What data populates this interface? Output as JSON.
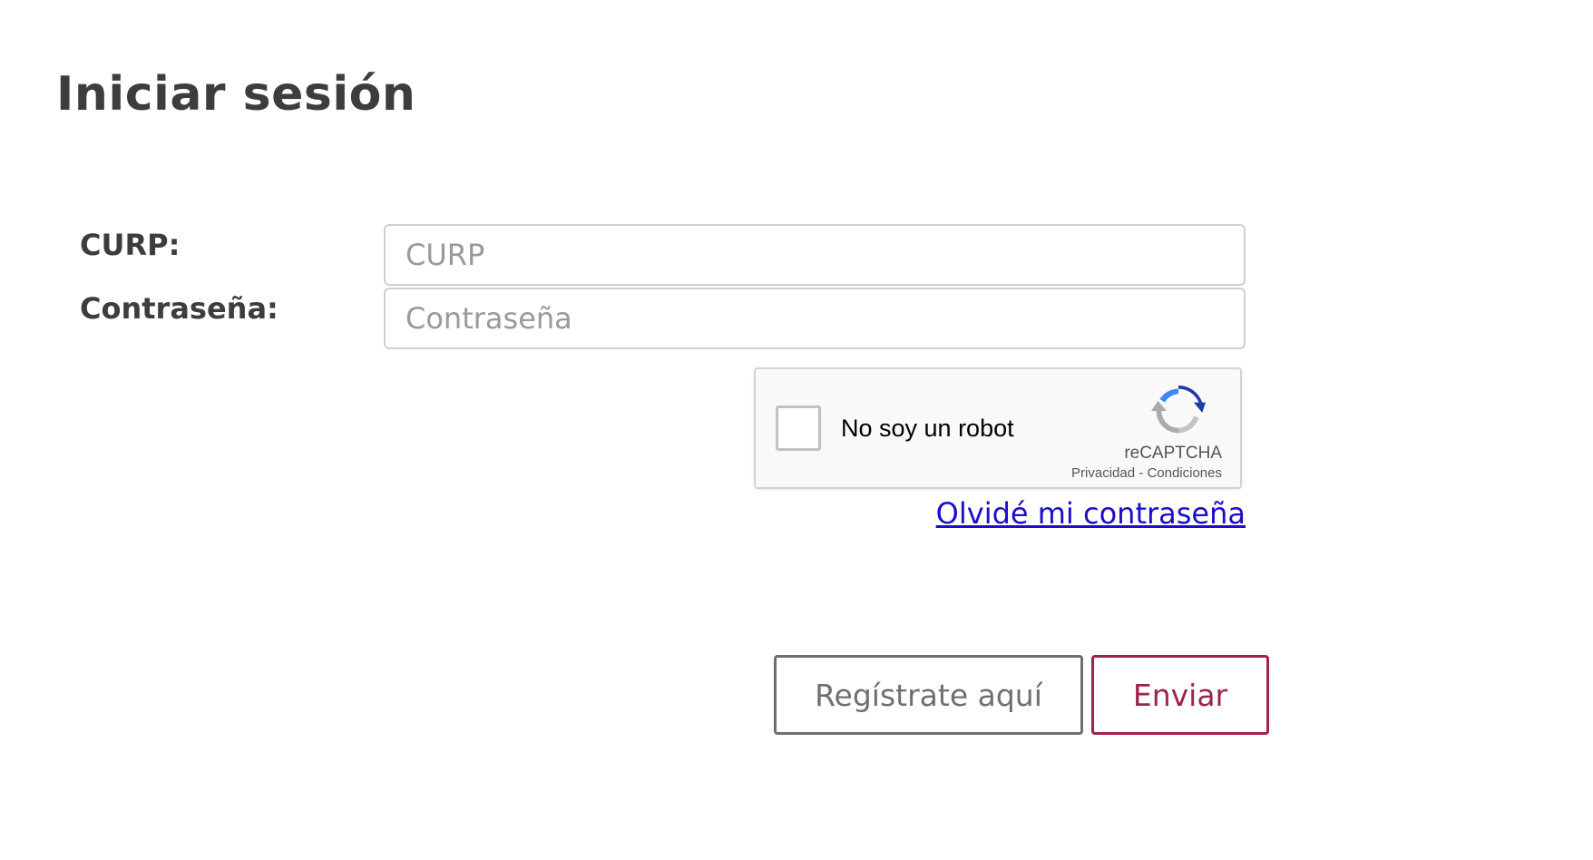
{
  "page": {
    "title": "Iniciar sesión"
  },
  "form": {
    "curp": {
      "label": "CURP:",
      "placeholder": "CURP",
      "value": ""
    },
    "password": {
      "label": "Contraseña:",
      "placeholder": "Contraseña",
      "value": ""
    },
    "recaptcha": {
      "checkbox_label": "No soy un robot",
      "brand": "reCAPTCHA",
      "privacy_link": "Privacidad",
      "separator": " - ",
      "terms_link": "Condiciones",
      "logo_icon": "recaptcha-logo-icon",
      "checked": false
    },
    "forgot_password_link": "Olvidé mi contraseña"
  },
  "actions": {
    "register_label": "Regístrate aquí",
    "submit_label": "Enviar"
  },
  "colors": {
    "text": "#3d3d3d",
    "link": "#1a0dcc",
    "accent": "#9d2449",
    "secondary_button": "#6f6f6f",
    "input_border": "#cfcfcf"
  }
}
